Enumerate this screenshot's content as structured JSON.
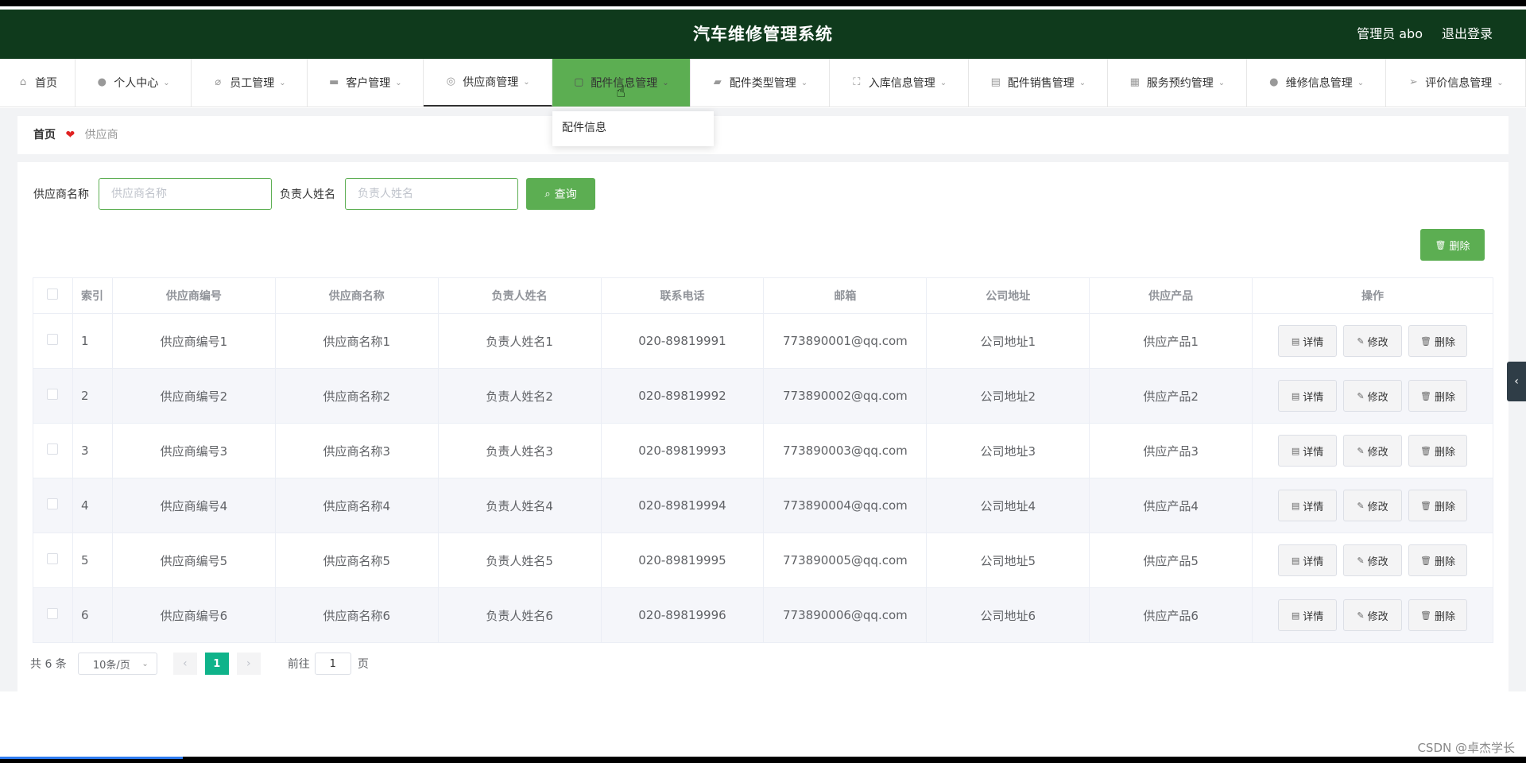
{
  "header": {
    "title": "汽车维修管理系统",
    "admin": "管理员 abo",
    "logout": "退出登录"
  },
  "nav": [
    {
      "label": "首页",
      "icon": "home-icon",
      "glyph": "⌂",
      "w": 95,
      "chev": ""
    },
    {
      "label": "个人中心",
      "icon": "user-icon",
      "glyph": "●",
      "w": 146,
      "chev": "⌄"
    },
    {
      "label": "员工管理",
      "icon": "bell-off-icon",
      "glyph": "⌀",
      "w": 146,
      "chev": "⌄"
    },
    {
      "label": "客户管理",
      "icon": "briefcase-icon",
      "glyph": "▬",
      "w": 146,
      "chev": "⌄"
    },
    {
      "label": "供应商管理",
      "icon": "compass-icon",
      "glyph": "◎",
      "w": 162,
      "chev": "⌄"
    },
    {
      "label": "配件信息管理",
      "icon": "copy-icon",
      "glyph": "▢",
      "w": 174,
      "chev": "⌄"
    },
    {
      "label": "配件类型管理",
      "icon": "ticket-icon",
      "glyph": "▰",
      "w": 175,
      "chev": "⌄"
    },
    {
      "label": "入库信息管理",
      "icon": "fullscreen-icon",
      "glyph": "⛶",
      "w": 175,
      "chev": "⌄"
    },
    {
      "label": "配件销售管理",
      "icon": "clipboard-icon",
      "glyph": "▤",
      "w": 175,
      "chev": "⌄"
    },
    {
      "label": "服务预约管理",
      "icon": "grid-icon",
      "glyph": "▦",
      "w": 175,
      "chev": "⌄"
    },
    {
      "label": "维修信息管理",
      "icon": "location-icon",
      "glyph": "●",
      "w": 175,
      "chev": "⌄"
    },
    {
      "label": "评价信息管理",
      "icon": "send-icon",
      "glyph": "➢",
      "w": 176,
      "chev": "⌄"
    }
  ],
  "dropdown": {
    "item": "配件信息"
  },
  "breadcrumb": {
    "home": "首页",
    "current": "供应商"
  },
  "search": {
    "label1": "供应商名称",
    "placeholder1": "供应商名称",
    "label2": "负责人姓名",
    "placeholder2": "负责人姓名",
    "button": "查询"
  },
  "toolbar": {
    "delete": "删除"
  },
  "table": {
    "headers": [
      "索引",
      "供应商编号",
      "供应商名称",
      "负责人姓名",
      "联系电话",
      "邮箱",
      "公司地址",
      "供应产品",
      "操作"
    ],
    "rows": [
      [
        "1",
        "供应商编号1",
        "供应商名称1",
        "负责人姓名1",
        "020-89819991",
        "773890001@qq.com",
        "公司地址1",
        "供应产品1"
      ],
      [
        "2",
        "供应商编号2",
        "供应商名称2",
        "负责人姓名2",
        "020-89819992",
        "773890002@qq.com",
        "公司地址2",
        "供应产品2"
      ],
      [
        "3",
        "供应商编号3",
        "供应商名称3",
        "负责人姓名3",
        "020-89819993",
        "773890003@qq.com",
        "公司地址3",
        "供应产品3"
      ],
      [
        "4",
        "供应商编号4",
        "供应商名称4",
        "负责人姓名4",
        "020-89819994",
        "773890004@qq.com",
        "公司地址4",
        "供应产品4"
      ],
      [
        "5",
        "供应商编号5",
        "供应商名称5",
        "负责人姓名5",
        "020-89819995",
        "773890005@qq.com",
        "公司地址5",
        "供应产品5"
      ],
      [
        "6",
        "供应商编号6",
        "供应商名称6",
        "负责人姓名6",
        "020-89819996",
        "773890006@qq.com",
        "公司地址6",
        "供应产品6"
      ]
    ],
    "actions": [
      "详情",
      "修改",
      "删除"
    ]
  },
  "pagination": {
    "total": "共 6 条",
    "page_size": "10条/页",
    "current": "1",
    "goto_prefix": "前往",
    "goto_value": "1",
    "goto_suffix": "页"
  },
  "watermark": "CSDN @卓杰学长"
}
